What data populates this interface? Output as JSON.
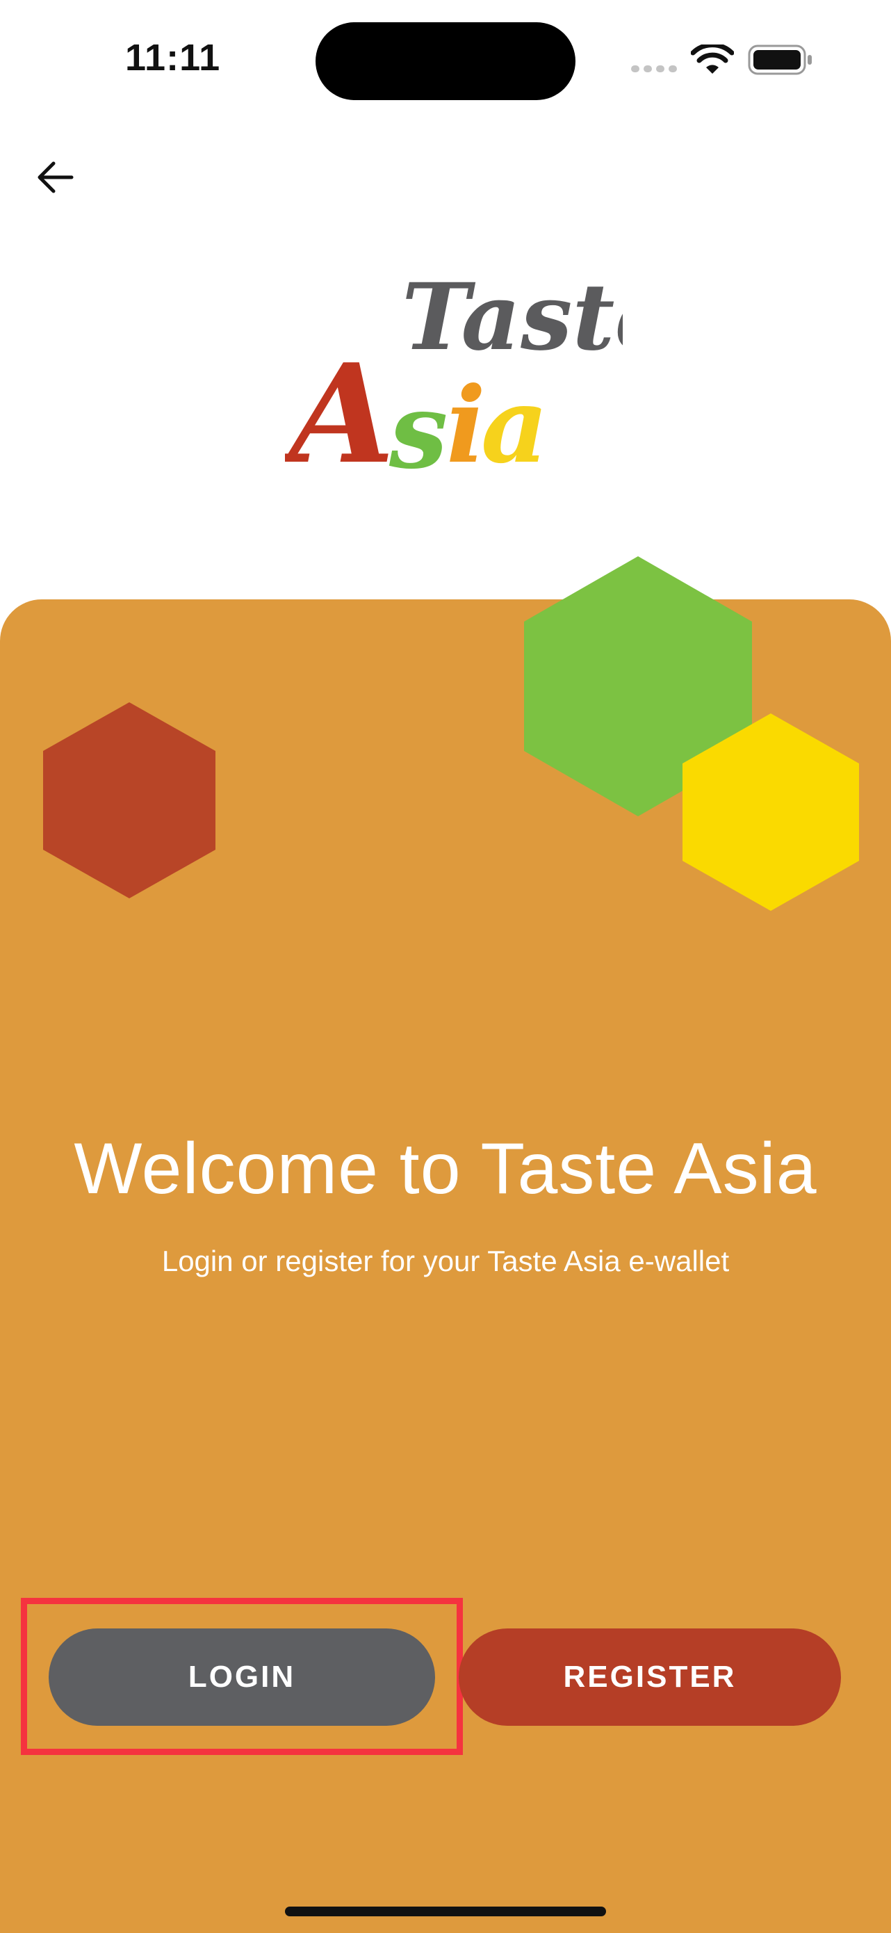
{
  "status_bar": {
    "time": "11:11"
  },
  "nav": {
    "back_icon": "arrow-left-icon"
  },
  "logo": {
    "line1": "Taste",
    "line2": "Asia",
    "colors": [
      "#C0351F",
      "#6FBE44",
      "#F09A1E",
      "#F6D21C",
      "#5B5B5D"
    ]
  },
  "welcome": {
    "title": "Welcome to Taste Asia",
    "subtitle": "Login or register for your Taste Asia e-wallet"
  },
  "actions": {
    "login_label": "LOGIN",
    "register_label": "REGISTER"
  },
  "colors": {
    "panel": "#DE9A3D",
    "hex_red": "#B84527",
    "hex_green": "#7CC242",
    "hex_yellow": "#FADA00",
    "login_bg": "#5E5F62",
    "register_bg": "#B53E26",
    "highlight": "#F5333F"
  }
}
